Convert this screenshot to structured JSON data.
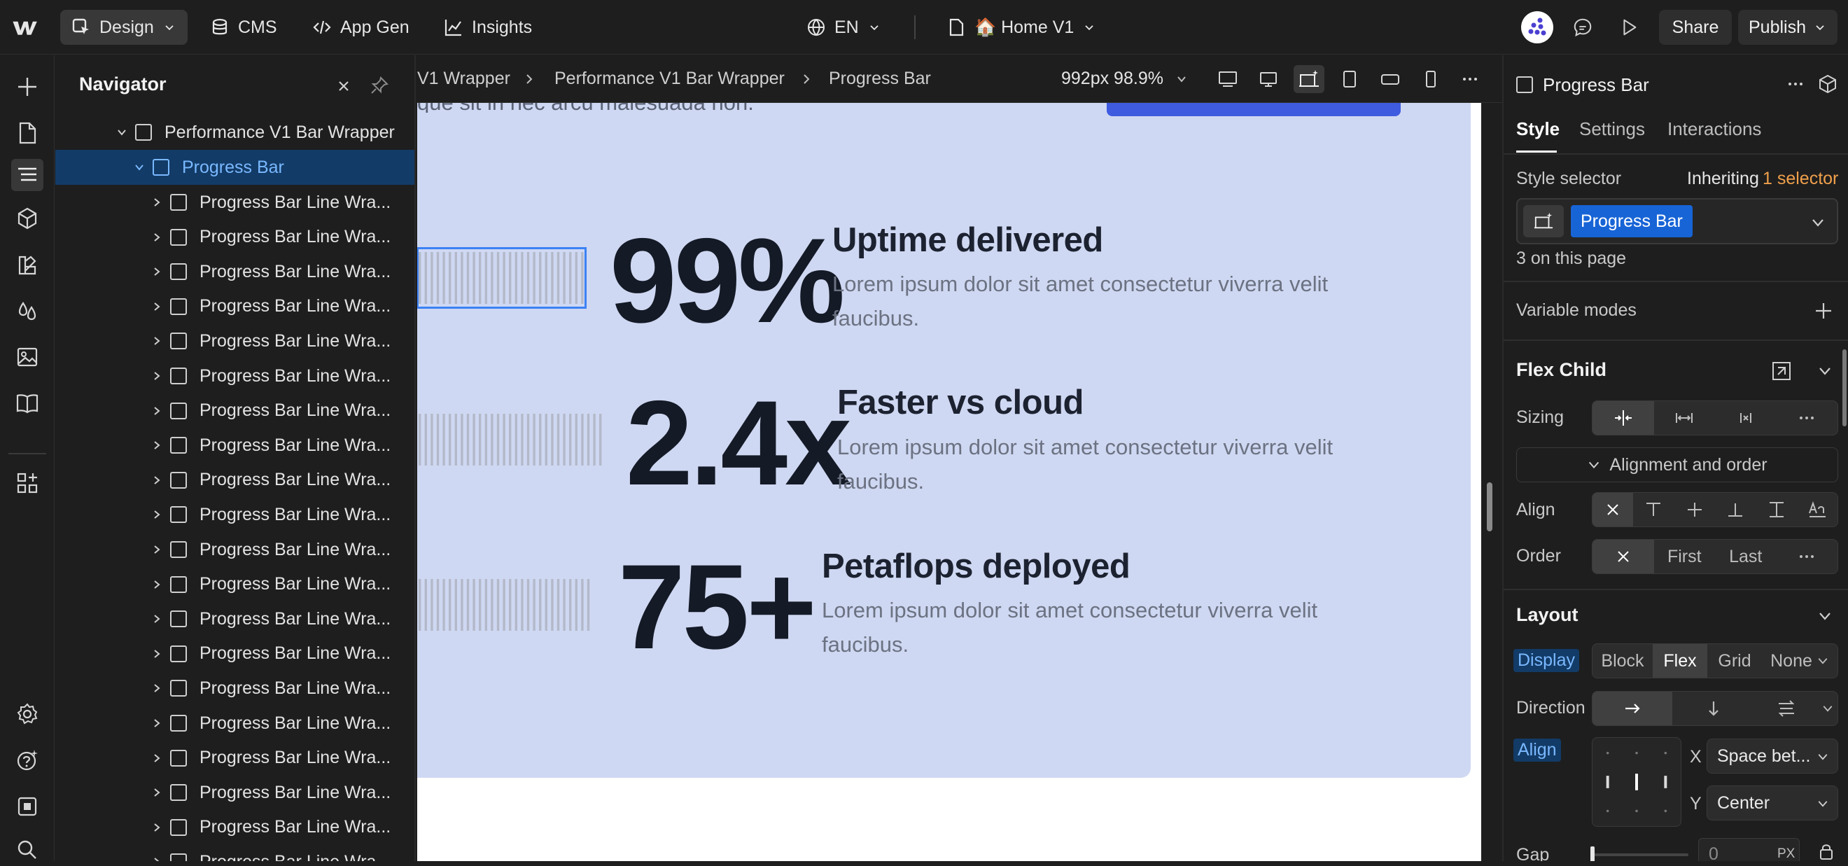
{
  "topbar": {
    "design_label": "Design",
    "cms_label": "CMS",
    "appgen_label": "App Gen",
    "insights_label": "Insights",
    "locale_label": "EN",
    "page_label": "🏠 Home V1",
    "share_label": "Share",
    "publish_label": "Publish"
  },
  "navigator": {
    "title": "Navigator",
    "parent": "Performance V1 Bar Wrapper",
    "selected": "Progress Bar",
    "children": [
      "Progress Bar Line Wra...",
      "Progress Bar Line Wra...",
      "Progress Bar Line Wra...",
      "Progress Bar Line Wra...",
      "Progress Bar Line Wra...",
      "Progress Bar Line Wra...",
      "Progress Bar Line Wra...",
      "Progress Bar Line Wra...",
      "Progress Bar Line Wra...",
      "Progress Bar Line Wra...",
      "Progress Bar Line Wra...",
      "Progress Bar Line Wra...",
      "Progress Bar Line Wra...",
      "Progress Bar Line Wra...",
      "Progress Bar Line Wra...",
      "Progress Bar Line Wra...",
      "Progress Bar Line Wra...",
      "Progress Bar Line Wra...",
      "Progress Bar Line Wra...",
      "Progress Bar Line Wra..."
    ]
  },
  "breadcrumb": {
    "items": [
      "V1 Wrapper",
      "Performance V1 Bar Wrapper",
      "Progress Bar"
    ],
    "viewport": "992px 98.9%"
  },
  "canvas": {
    "cut_text": "que sit in nec arcu malesuada non.",
    "stats": [
      {
        "value": "99%",
        "title": "Uptime delivered",
        "desc": "Lorem ipsum dolor sit amet consectetur viverra velit faucibus."
      },
      {
        "value": "2.4x",
        "title": "Faster vs cloud",
        "desc": "Lorem ipsum dolor sit amet consectetur viverra velit faucibus."
      },
      {
        "value": "75+",
        "title": "Petaflops deployed",
        "desc": "Lorem ipsum dolor sit amet consectetur viverra velit faucibus."
      }
    ]
  },
  "panel": {
    "element_name": "Progress Bar",
    "tabs": [
      "Style",
      "Settings",
      "Interactions"
    ],
    "style_selector_label": "Style selector",
    "inheriting_prefix": "Inheriting",
    "inheriting_link": "1 selector",
    "selector_chip": "Progress Bar",
    "on_page": "3 on this page",
    "variable_modes": "Variable modes",
    "flex_child": "Flex Child",
    "sizing_label": "Sizing",
    "alignment_order": "Alignment and order",
    "align_label": "Align",
    "order_label": "Order",
    "order_first": "First",
    "order_last": "Last",
    "layout_title": "Layout",
    "display_label": "Display",
    "display_options": [
      "Block",
      "Flex",
      "Grid",
      "None"
    ],
    "display_selected": "Flex",
    "direction_label": "Direction",
    "align2_label": "Align",
    "x_label": "X",
    "x_value": "Space bet...",
    "y_label": "Y",
    "y_value": "Center",
    "gap_label": "Gap",
    "gap_value": "0",
    "gap_unit": "PX"
  },
  "colors": {
    "accent": "#1764d6",
    "section_bg": "#cfd8f2",
    "selector_link": "#f0a04b"
  }
}
